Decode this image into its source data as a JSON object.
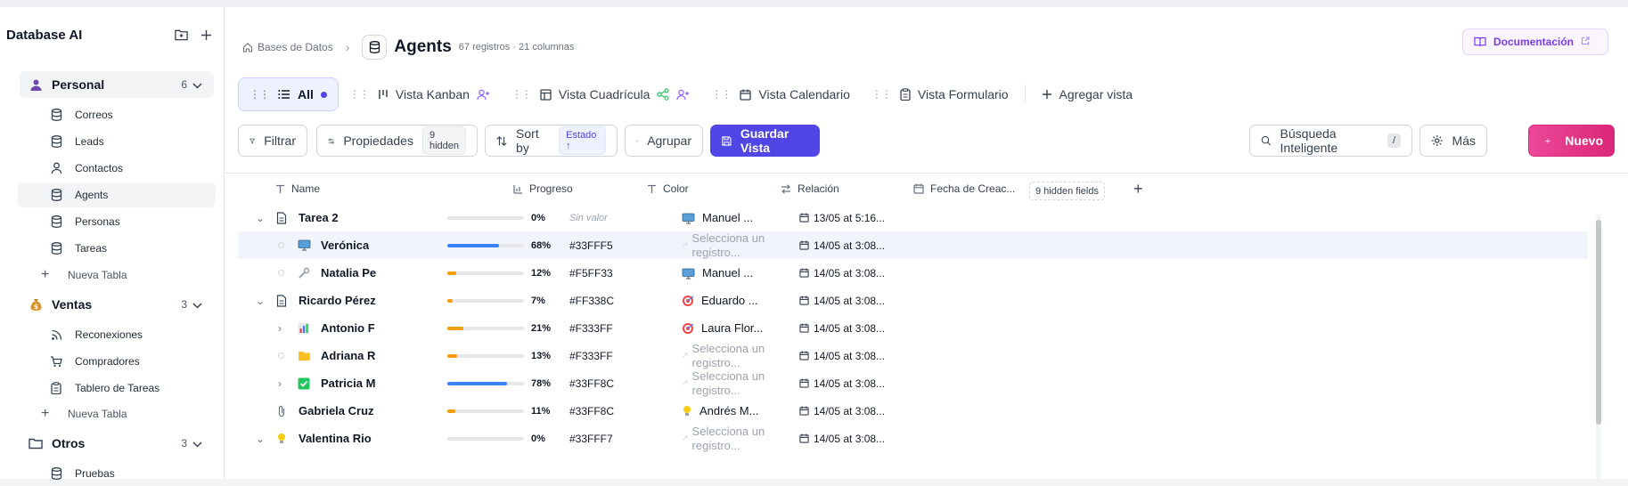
{
  "sidebar": {
    "title": "Database AI",
    "groups": [
      {
        "label": "Personal",
        "count": "6",
        "items": [
          "Correos",
          "Leads",
          "Contactos",
          "Agents",
          "Personas",
          "Tareas"
        ],
        "add_label": "Nueva Tabla"
      },
      {
        "label": "Ventas",
        "count": "3",
        "items": [
          "Reconexiones",
          "Compradores",
          "Tablero de Tareas"
        ],
        "add_label": "Nueva Tabla"
      },
      {
        "label": "Otros",
        "count": "3",
        "items": [
          "Pruebas"
        ]
      }
    ]
  },
  "header": {
    "breadcrumb_root": "Bases de Datos",
    "title": "Agents",
    "meta": "67 registros · 21 columnas",
    "doc_button": "Documentación"
  },
  "views": [
    {
      "label": "All",
      "active": true
    },
    {
      "label": "Vista Kanban"
    },
    {
      "label": "Vista Cuadrícula"
    },
    {
      "label": "Vista Calendario"
    },
    {
      "label": "Vista Formulario"
    },
    {
      "label": "Agregar vista"
    }
  ],
  "toolbar": {
    "filter": "Filtrar",
    "properties": "Propiedades",
    "properties_hidden": "9 hidden",
    "sort": "Sort by",
    "sort_field": "Estado ↑",
    "group": "Agrupar",
    "save_view": "Guardar Vista",
    "search": "Búsqueda Inteligente",
    "search_kbd": "/",
    "more": "Más",
    "new": "Nuevo"
  },
  "columns": {
    "name": "Name",
    "progress": "Progreso",
    "color": "Color",
    "relation": "Relación",
    "date": "Fecha de Creac...",
    "hidden_fields": "9 hidden fields"
  },
  "rows": [
    {
      "name": "Tarea 2",
      "progress": 0,
      "progress_label": "0%",
      "color": "Sin valor",
      "relation": "Manuel ...",
      "date": "13/05 at 5:16..."
    },
    {
      "name": "Verónica",
      "progress": 68,
      "progress_label": "68%",
      "color": "#33FFF5",
      "relation": "Selecciona un registro...",
      "date": "14/05 at 3:08..."
    },
    {
      "name": "Natalia Pe",
      "progress": 12,
      "progress_label": "12%",
      "color": "#F5FF33",
      "relation": "Manuel ...",
      "date": "14/05 at 3:08..."
    },
    {
      "name": "Ricardo Pérez",
      "progress": 7,
      "progress_label": "7%",
      "color": "#FF338C",
      "relation": "Eduardo ...",
      "date": "14/05 at 3:08..."
    },
    {
      "name": "Antonio F",
      "progress": 21,
      "progress_label": "21%",
      "color": "#F333FF",
      "relation": "Laura Flor...",
      "date": "14/05 at 3:08..."
    },
    {
      "name": "Adriana R",
      "progress": 13,
      "progress_label": "13%",
      "color": "#F333FF",
      "relation": "Selecciona un registro...",
      "date": "14/05 at 3:08..."
    },
    {
      "name": "Patricia M",
      "progress": 78,
      "progress_label": "78%",
      "color": "#33FF8C",
      "relation": "Selecciona un registro...",
      "date": "14/05 at 3:08..."
    },
    {
      "name": "Gabriela Cruz",
      "progress": 11,
      "progress_label": "11%",
      "color": "#33FF8C",
      "relation": "Andrés M...",
      "date": "14/05 at 3:08..."
    },
    {
      "name": "Valentina Rio",
      "progress": 0,
      "progress_label": "0%",
      "color": "#33FFF7",
      "relation": "Selecciona un registro...",
      "date": "14/05 at 3:08..."
    }
  ],
  "colors": {
    "accent": "#4f46e5",
    "new_button": "#ec4899",
    "bar_blue": "#3b82f6",
    "bar_orange": "#f59e0b"
  }
}
